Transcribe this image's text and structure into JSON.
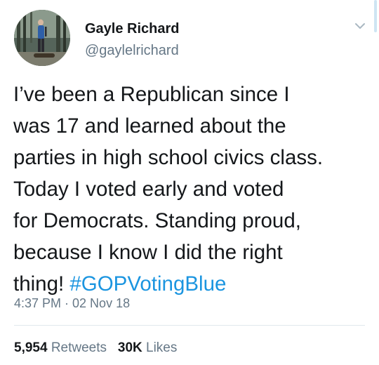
{
  "author": {
    "display_name": "Gayle Richard",
    "handle": "@gaylelrichard"
  },
  "tweet": {
    "text_lines": [
      "I’ve been a Republican since I",
      "was 17 and learned about the",
      "parties in high school civics class.",
      "Today I voted early and voted",
      "for Democrats. Standing proud,",
      "because I know  I did the right"
    ],
    "last_line_text": "thing! ",
    "hashtag": "#GOPVotingBlue",
    "timestamp": "4:37 PM · 02 Nov 18"
  },
  "stats": {
    "retweets_count": "5,954",
    "retweets_label": "Retweets",
    "likes_count": "30K",
    "likes_label": "Likes"
  },
  "icons": {
    "more_menu": "chevron-down-icon"
  },
  "colors": {
    "link": "#1b95e0",
    "secondary_text": "#657786",
    "primary_text": "#14171a",
    "divider": "#e1e8ed"
  }
}
